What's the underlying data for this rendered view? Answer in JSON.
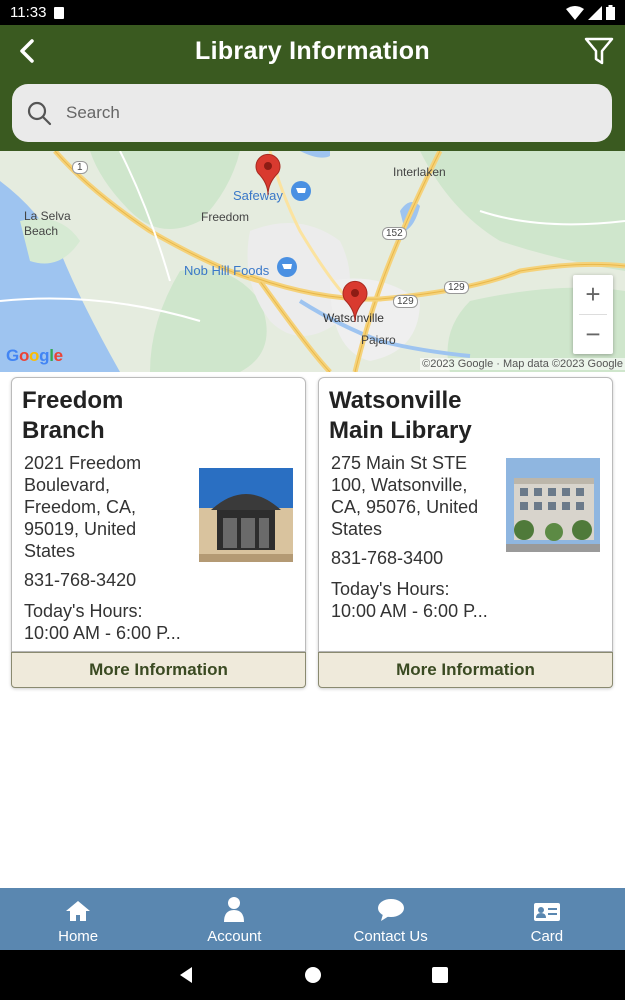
{
  "status_bar": {
    "time": "11:33"
  },
  "header": {
    "title": "Library Information"
  },
  "search": {
    "placeholder": "Search"
  },
  "map": {
    "labels": {
      "interlaken": "Interlaken",
      "la_selva": "La Selva\nBeach",
      "freedom": "Freedom",
      "safeway": "Safeway",
      "nob_hill": "Nob Hill Foods",
      "watsonville": "Watsonville",
      "pajaro": "Pajaro",
      "route_1": "1",
      "route_152": "152",
      "route_129a": "129",
      "route_129b": "129"
    },
    "zoom_in": "+",
    "zoom_out": "−",
    "logo": "Google",
    "attribution": "©2023 Google · Map data ©2023 Google"
  },
  "libraries": [
    {
      "name": "Freedom Branch",
      "address": "2021 Freedom Boulevard, Freedom, CA, 95019, United States",
      "phone": "831-768-3420",
      "hours_label": "Today's Hours:",
      "hours": "10:00 AM - 6:00 P...",
      "button": "More Information"
    },
    {
      "name": "Watsonville Main Library",
      "address": "275 Main St STE 100, Watsonville, CA, 95076, United States",
      "phone": "831-768-3400",
      "hours_label": "Today's Hours:",
      "hours": "10:00 AM - 6:00 P...",
      "button": "More Information"
    }
  ],
  "bottom_nav": [
    {
      "label": "Home",
      "icon": "home-icon"
    },
    {
      "label": "Account",
      "icon": "account-icon"
    },
    {
      "label": "Contact Us",
      "icon": "chat-icon"
    },
    {
      "label": "Card",
      "icon": "card-icon"
    }
  ],
  "colors": {
    "app_bar": "#3a5a20",
    "bottom_nav": "#5a87b0",
    "button_bg": "#efeadb",
    "pin": "#d93a2f"
  }
}
